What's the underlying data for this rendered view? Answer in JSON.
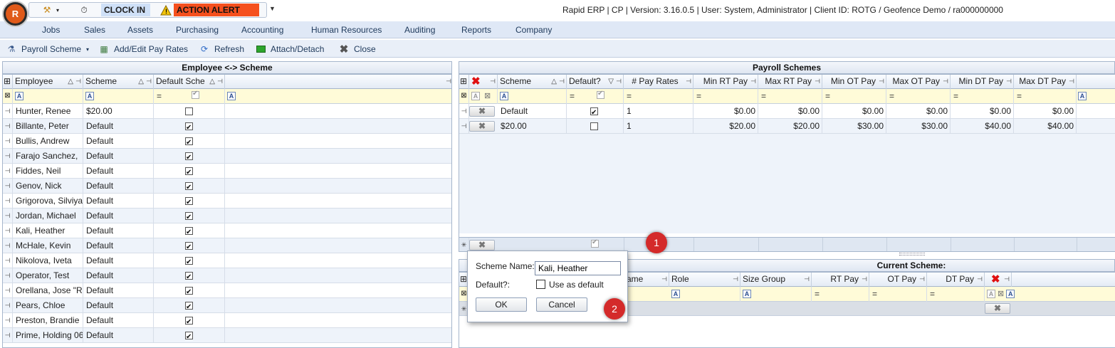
{
  "titlebar": {
    "clock_in": "CLOCK IN",
    "action_alert": "ACTION ALERT",
    "app_title": "Rapid ERP | CP | Version: 3.16.0.5 | User: System, Administrator | Client ID: ROTG / Geofence Demo / ra000000000",
    "logo_text": "R"
  },
  "menu": [
    "Jobs",
    "Sales",
    "Assets",
    "Purchasing",
    "Accounting",
    "Human Resources",
    "Auditing",
    "Reports",
    "Company"
  ],
  "toolbar": {
    "payroll_scheme": "Payroll Scheme",
    "add_edit_pay_rates": "Add/Edit Pay Rates",
    "refresh": "Refresh",
    "attach_detach": "Attach/Detach",
    "close": "Close"
  },
  "employee_panel": {
    "title": "Employee <-> Scheme",
    "columns": [
      "Employee",
      "Scheme",
      "Default Sche"
    ],
    "rows": [
      {
        "employee": "Hunter, Renee",
        "scheme": "$20.00",
        "default": false
      },
      {
        "employee": "Billante, Peter",
        "scheme": "Default",
        "default": true
      },
      {
        "employee": "Bullis, Andrew",
        "scheme": "Default",
        "default": true
      },
      {
        "employee": "Farajo Sanchez,",
        "scheme": "Default",
        "default": true
      },
      {
        "employee": "Fiddes, Neil",
        "scheme": "Default",
        "default": true
      },
      {
        "employee": "Genov, Nick",
        "scheme": "Default",
        "default": true
      },
      {
        "employee": "Grigorova, Silviya",
        "scheme": "Default",
        "default": true
      },
      {
        "employee": "Jordan, Michael",
        "scheme": "Default",
        "default": true
      },
      {
        "employee": "Kali, Heather",
        "scheme": "Default",
        "default": true
      },
      {
        "employee": "McHale, Kevin",
        "scheme": "Default",
        "default": true
      },
      {
        "employee": "Nikolova, Iveta",
        "scheme": "Default",
        "default": true
      },
      {
        "employee": "Operator, Test",
        "scheme": "Default",
        "default": true
      },
      {
        "employee": "Orellana, Jose \"R",
        "scheme": "Default",
        "default": true
      },
      {
        "employee": "Pears, Chloe",
        "scheme": "Default",
        "default": true
      },
      {
        "employee": "Preston, Brandie",
        "scheme": "Default",
        "default": true
      },
      {
        "employee": "Prime, Holding 06",
        "scheme": "Default",
        "default": true
      }
    ]
  },
  "payroll_panel": {
    "title": "Payroll Schemes",
    "columns": [
      "Scheme",
      "Default?",
      "# Pay Rates",
      "Min RT Pay",
      "Max RT Pay",
      "Min OT Pay",
      "Max OT Pay",
      "Min DT Pay",
      "Max DT Pay"
    ],
    "rows": [
      {
        "scheme": "Default",
        "default": true,
        "pay_rates": "1",
        "min_rt": "$0.00",
        "max_rt": "$0.00",
        "min_ot": "$0.00",
        "max_ot": "$0.00",
        "min_dt": "$0.00",
        "max_dt": "$0.00"
      },
      {
        "scheme": "$20.00",
        "default": false,
        "pay_rates": "1",
        "min_rt": "$20.00",
        "max_rt": "$20.00",
        "min_ot": "$30.00",
        "max_ot": "$30.00",
        "min_dt": "$40.00",
        "max_dt": "$40.00"
      }
    ]
  },
  "current_panel": {
    "title": "Current Scheme:",
    "columns": [
      "ame",
      "Role",
      "Size Group",
      "RT Pay",
      "OT Pay",
      "DT Pay"
    ]
  },
  "dialog": {
    "scheme_name_label": "Scheme Name:",
    "scheme_name_value": "Kali, Heather",
    "default_label": "Default?:",
    "use_as_default": "Use as default",
    "ok": "OK",
    "cancel": "Cancel"
  },
  "badges": [
    "1",
    "2"
  ],
  "colors": {
    "alert": "#f5501e",
    "clock_in": "#cfe0f7",
    "badge": "#d42a2a",
    "filter_row": "#fffbd8"
  }
}
